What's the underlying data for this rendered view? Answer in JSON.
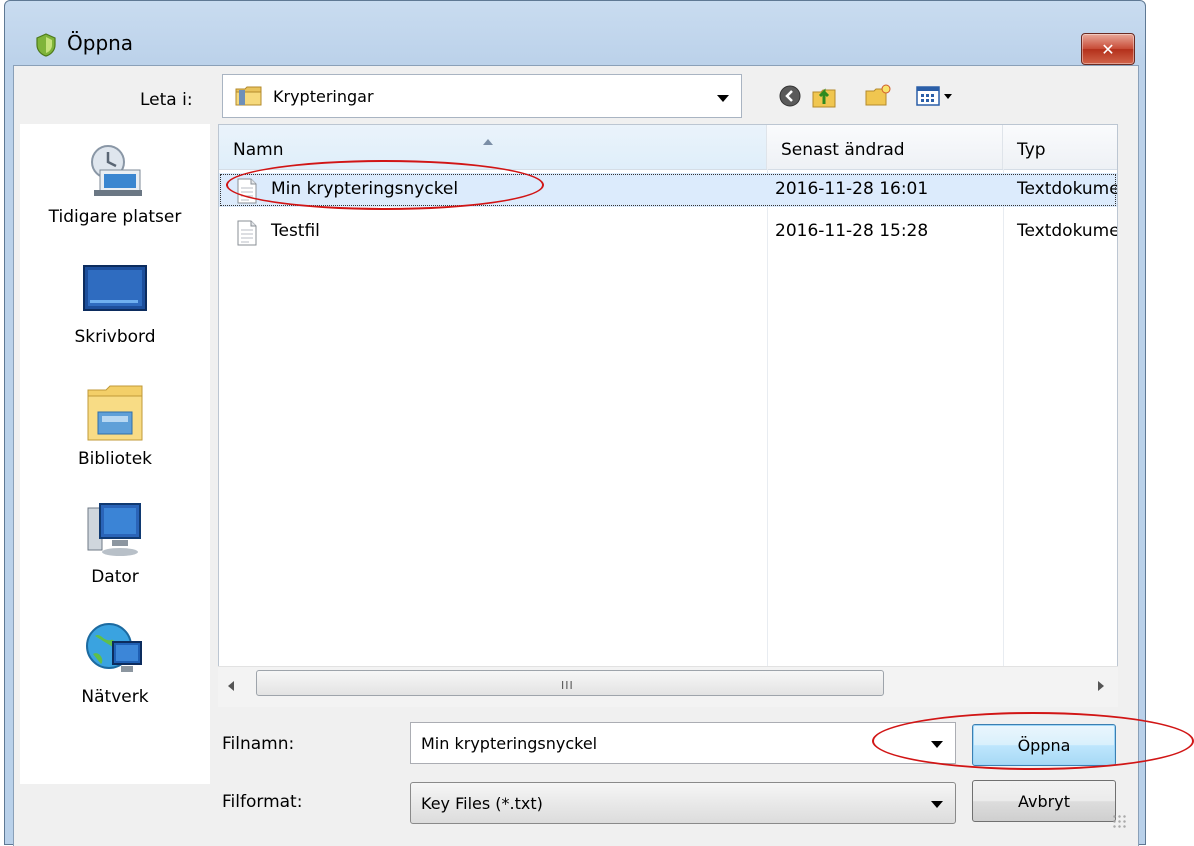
{
  "window": {
    "title": "Öppna",
    "close_glyph": "✕"
  },
  "lookin": {
    "label": "Leta i:",
    "value": "Krypteringar"
  },
  "toolbar": [
    "back-icon",
    "up-folder-icon",
    "new-folder-icon",
    "view-menu-icon"
  ],
  "places": [
    {
      "name": "recent-places",
      "label": "Tidigare platser",
      "icon": "recent-places-icon"
    },
    {
      "name": "desktop",
      "label": "Skrivbord",
      "icon": "desktop-icon"
    },
    {
      "name": "libraries",
      "label": "Bibliotek",
      "icon": "libraries-icon"
    },
    {
      "name": "computer",
      "label": "Dator",
      "icon": "computer-icon"
    },
    {
      "name": "network",
      "label": "Nätverk",
      "icon": "network-icon"
    }
  ],
  "columns": {
    "name": "Namn",
    "modified": "Senast ändrad",
    "type": "Typ"
  },
  "files": [
    {
      "name": "Min krypteringsnyckel",
      "modified": "2016-11-28 16:01",
      "type": "Textdokument",
      "selected": true
    },
    {
      "name": "Testfil",
      "modified": "2016-11-28 15:28",
      "type": "Textdokument",
      "selected": false
    }
  ],
  "scrollbar": {
    "grip": "III"
  },
  "filename": {
    "label": "Filnamn:",
    "value": "Min krypteringsnyckel"
  },
  "filetype": {
    "label": "Filformat:",
    "value": "Key Files (*.txt)"
  },
  "buttons": {
    "open": "Öppna",
    "cancel": "Avbryt"
  },
  "colors": {
    "annotation": "#d11515",
    "selection": "#dcebfc"
  }
}
